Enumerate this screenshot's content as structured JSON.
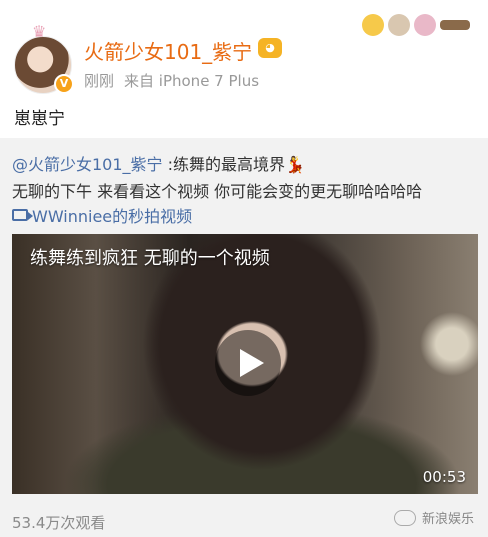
{
  "post": {
    "username": "火箭少女101_紫宁",
    "time": "刚刚",
    "source": "来自 iPhone 7 Plus",
    "text": "崽崽宁"
  },
  "repost": {
    "mention": "@火箭少女101_紫宁",
    "title": " :练舞的最高境界",
    "body": "无聊的下午 来看看这个视频 你可能会变的更无聊哈哈哈哈",
    "video_link": "WWinniee的秒拍视频",
    "video": {
      "caption": "练舞练到疯狂 无聊的一个视频",
      "duration": "00:53"
    },
    "views": "53.4万次观看"
  },
  "watermark": "新浪娱乐",
  "colors": {
    "username": "#e86b13",
    "link": "#4a6ea6",
    "repost_bg": "#f2f2f2"
  }
}
